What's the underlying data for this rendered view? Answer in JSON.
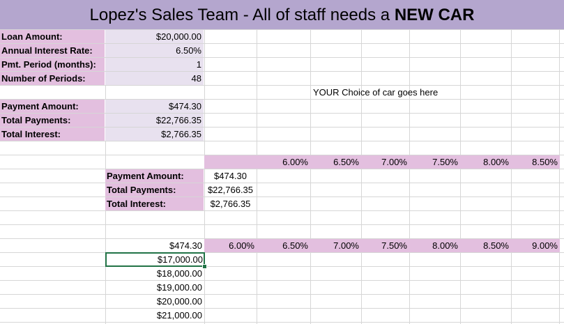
{
  "title": {
    "text": "Lopez's Sales Team - All of staff needs a",
    "emphasis": "NEW CAR"
  },
  "inputs": [
    {
      "label": "Loan Amount:",
      "value": "$20,000.00"
    },
    {
      "label": "Annual Interest Rate:",
      "value": "6.50%"
    },
    {
      "label": "Pmt. Period (months):",
      "value": "1"
    },
    {
      "label": "Number of Periods:",
      "value": "48"
    }
  ],
  "note": "YOUR Choice of car goes here",
  "results": [
    {
      "label": "Payment Amount:",
      "value": "$474.30"
    },
    {
      "label": "Total Payments:",
      "value": "$22,766.35"
    },
    {
      "label": "Total Interest:",
      "value": "$2,766.35"
    }
  ],
  "rates_row_1": [
    "6.00%",
    "6.50%",
    "7.00%",
    "7.50%",
    "8.00%",
    "8.50%"
  ],
  "results2": [
    {
      "label": "Payment Amount:",
      "value": "$474.30"
    },
    {
      "label": "Total Payments:",
      "value": "$22,766.35"
    },
    {
      "label": "Total Interest:",
      "value": "$2,766.35"
    }
  ],
  "table2": {
    "corner": "$474.30",
    "rates": [
      "6.00%",
      "6.50%",
      "7.00%",
      "7.50%",
      "8.00%",
      "8.50%",
      "9.00%"
    ],
    "amounts": [
      "$17,000.00",
      "$18,000.00",
      "$19,000.00",
      "$20,000.00",
      "$21,000.00"
    ]
  },
  "colors": {
    "title_bg": "#b4a6ce",
    "label_bg": "#e3bfdf",
    "value_bg": "#e8e1ef",
    "selection": "#217346"
  }
}
